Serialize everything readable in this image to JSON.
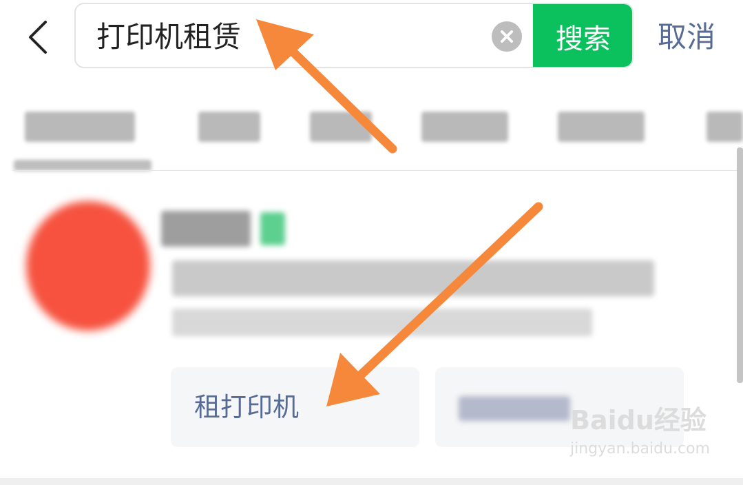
{
  "search": {
    "query": "打印机租赁",
    "submit_label": "搜索",
    "cancel_label": "取消"
  },
  "suggestion": {
    "label": "租打印机"
  },
  "watermark": {
    "brand": "Baidu经验",
    "url": "jingyan.baidu.com"
  },
  "colors": {
    "search_button": "#0ac15d",
    "link_text": "#576b95",
    "arrow": "#f5883a"
  },
  "icons": [
    "back-arrow-icon",
    "clear-icon"
  ]
}
